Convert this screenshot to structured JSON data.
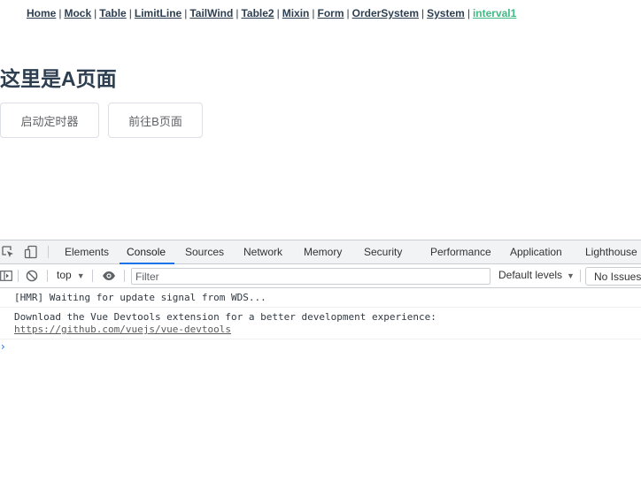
{
  "nav": {
    "links": [
      {
        "label": "Home"
      },
      {
        "label": "Mock"
      },
      {
        "label": "Table"
      },
      {
        "label": "LimitLine"
      },
      {
        "label": "TailWind"
      },
      {
        "label": "Table2"
      },
      {
        "label": "Mixin"
      },
      {
        "label": "Form"
      },
      {
        "label": "OrderSystem"
      },
      {
        "label": "System"
      },
      {
        "label": "interval1"
      }
    ],
    "separator": "|",
    "active_color": "#42b983",
    "link_color": "#2c3e50"
  },
  "main": {
    "title": "这里是A页面",
    "start_timer_button": "启动定时器",
    "goto_b_button": "前往B页面"
  },
  "devtools": {
    "tabs": [
      "Elements",
      "Console",
      "Sources",
      "Network",
      "Memory",
      "Security",
      "Performance",
      "Application",
      "Lighthouse"
    ],
    "selected_tab": "Console",
    "accent_color": "#1a73e8",
    "toolbar": {
      "context": "top",
      "filter_placeholder": "Filter",
      "filter_value": "",
      "levels": "Default levels",
      "issues": "No Issues"
    },
    "console": {
      "line1": "[HMR] Waiting for update signal from WDS...",
      "line2": "Download the Vue Devtools extension for a better development experience:",
      "line2_link": "https://github.com/vuejs/vue-devtools",
      "prompt_chevron": "›"
    },
    "icons": {
      "inspect": "inspect-element-icon",
      "device": "device-toggle-icon",
      "sidebar": "console-sidebar-icon",
      "clear": "clear-console-icon",
      "eye": "live-expression-eye-icon"
    }
  }
}
